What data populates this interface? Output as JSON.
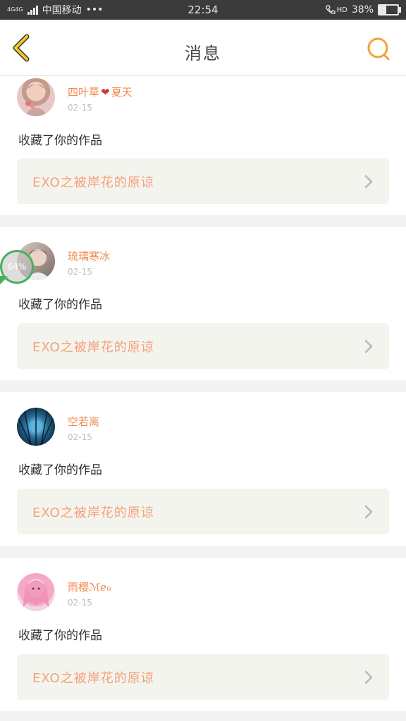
{
  "status_bar": {
    "network_label": "4G4G",
    "carrier": "中国移动",
    "more": "•••",
    "time": "22:54",
    "hd_label": "HD",
    "battery_percent": "38%",
    "battery_level": 0.38,
    "icons": [
      "signal-icon",
      "phone-hd-icon",
      "battery-icon"
    ]
  },
  "header": {
    "title": "消息",
    "back_icon": "back-chevron-icon",
    "search_icon": "search-icon",
    "accent_color": "#f3a23a"
  },
  "notifications": [
    {
      "username_pre": "四叶草",
      "username_post": "夏天",
      "has_heart": true,
      "date": "02-15",
      "action": "收藏了你的作品",
      "work_title": "EXO之被岸花的原谅"
    },
    {
      "username_pre": "琉璃寒冰",
      "username_post": "",
      "has_heart": false,
      "date": "02-15",
      "action": "收藏了你的作品",
      "work_title": "EXO之被岸花的原谅"
    },
    {
      "username_pre": "空若离",
      "username_post": "",
      "has_heart": false,
      "date": "02-15",
      "action": "收藏了你的作品",
      "work_title": "EXO之被岸花的原谅"
    },
    {
      "username_pre": "雨樱ℳℯℴ",
      "username_post": "",
      "has_heart": false,
      "date": "02-15",
      "action": "收藏了你的作品",
      "work_title": "EXO之被岸花的原谅"
    }
  ],
  "floating_widget": {
    "label": "64%",
    "accent_color": "#48b05a"
  },
  "colors": {
    "username": "#f08a4f",
    "work_title": "#f4a07a",
    "card_bg": "#ffffff",
    "work_bg": "#f4f4ee"
  }
}
